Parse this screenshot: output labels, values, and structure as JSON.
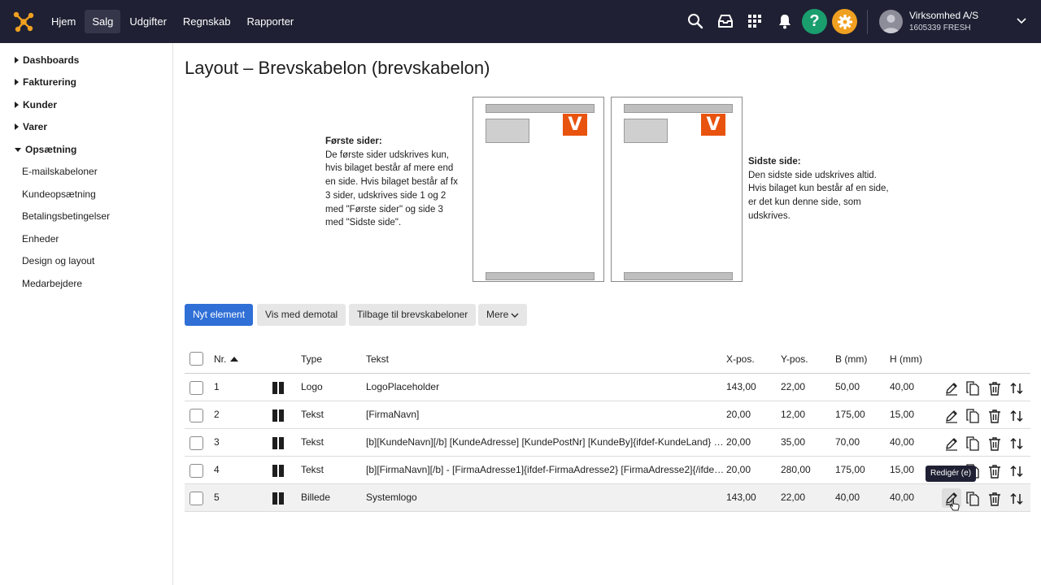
{
  "topbar": {
    "nav": [
      "Hjem",
      "Salg",
      "Udgifter",
      "Regnskab",
      "Rapporter"
    ],
    "active_nav": "Salg",
    "help_label": "?",
    "company_name": "Virksomhed A/S",
    "company_sub": "1605339 FRESH",
    "colors": {
      "bar": "#1f2033",
      "help": "#1a9e6e",
      "settings": "#f0a020",
      "logo": "#f0a020"
    }
  },
  "sidebar": {
    "groups": [
      {
        "label": "Dashboards",
        "expanded": false
      },
      {
        "label": "Fakturering",
        "expanded": false
      },
      {
        "label": "Kunder",
        "expanded": false
      },
      {
        "label": "Varer",
        "expanded": false
      },
      {
        "label": "Opsætning",
        "expanded": true
      }
    ],
    "items": [
      "E-mailskabeloner",
      "Kundeopsætning",
      "Betalingsbetingelser",
      "Enheder",
      "Design og layout",
      "Medarbejdere"
    ]
  },
  "page": {
    "title": "Layout – Brevskabelon (brevskabelon)",
    "first_pages": {
      "title": "Første sider:",
      "text": "De første sider udskrives kun, hvis bilaget består af mere end en side. Hvis bilaget består af fx 3 sider, udskrives side 1 og 2 med \"Første sider\" og side 3 med \"Sidste side\"."
    },
    "last_page": {
      "title": "Sidste side:",
      "text": "Den sidste side udskrives altid. Hvis bilaget kun består af en side, er det kun denne side, som udskrives."
    },
    "preview_logo_letter": "V"
  },
  "actions": {
    "new_element": "Nyt element",
    "show_demo": "Vis med demotal",
    "back": "Tilbage til brevskabeloner",
    "more": "Mere"
  },
  "table": {
    "headers": {
      "nr": "Nr.",
      "type": "Type",
      "text": "Tekst",
      "x": "X-pos.",
      "y": "Y-pos.",
      "w": "B (mm)",
      "h": "H (mm)"
    },
    "rows": [
      {
        "nr": "1",
        "type": "Logo",
        "text": "LogoPlaceholder",
        "x": "143,00",
        "y": "22,00",
        "w": "50,00",
        "h": "40,00"
      },
      {
        "nr": "2",
        "type": "Tekst",
        "text": "[FirmaNavn]",
        "x": "20,00",
        "y": "12,00",
        "w": "175,00",
        "h": "15,00"
      },
      {
        "nr": "3",
        "type": "Tekst",
        "text": "[b][KundeNavn][/b] [KundeAdresse] [KundePostNr] [KundeBy]{ifdef-KundeLand} …",
        "x": "20,00",
        "y": "35,00",
        "w": "70,00",
        "h": "40,00"
      },
      {
        "nr": "4",
        "type": "Tekst",
        "text": "[b][FirmaNavn][/b] - [FirmaAdresse1]{ifdef-FirmaAdresse2} [FirmaAdresse2]{/ifde…",
        "x": "20,00",
        "y": "280,00",
        "w": "175,00",
        "h": "15,00"
      },
      {
        "nr": "5",
        "type": "Billede",
        "text": "Systemlogo",
        "x": "143,00",
        "y": "22,00",
        "w": "40,00",
        "h": "40,00"
      }
    ],
    "tooltip": "Redigér (e)"
  }
}
